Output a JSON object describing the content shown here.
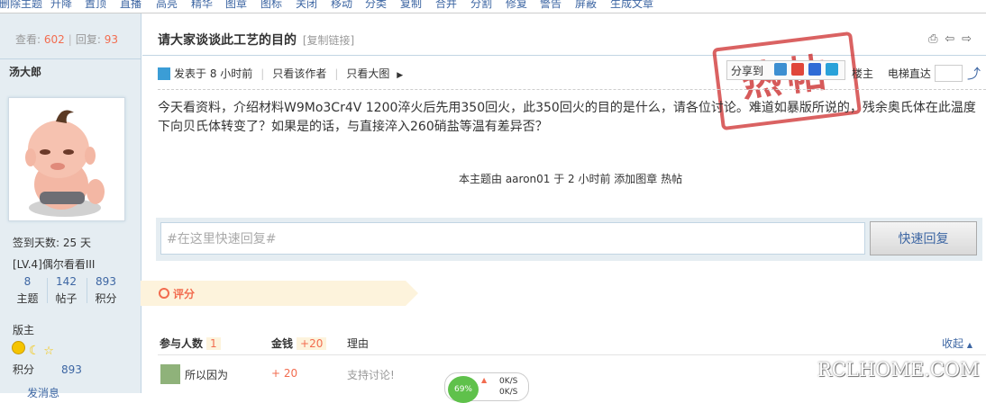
{
  "topbar": {
    "items": [
      "删除主题",
      "升降",
      "置顶",
      "直播",
      "高亮",
      "精华",
      "图章",
      "图标",
      "关闭",
      "移动",
      "分类",
      "复制",
      "合并",
      "分割",
      "修复",
      "警告",
      "屏蔽",
      "生成文章"
    ]
  },
  "sidebar": {
    "views_label": "查看:",
    "views": "602",
    "replies_label": "回复:",
    "replies": "93",
    "author": "汤大郎",
    "signin": "签到天数: 25 天",
    "level": "[LV.4]偶尔看看III",
    "counts": [
      {
        "num": "8",
        "label": "主题"
      },
      {
        "num": "142",
        "label": "帖子"
      },
      {
        "num": "893",
        "label": "积分"
      }
    ],
    "role": "版主",
    "score_label": "积分",
    "score_value": "893"
  },
  "post": {
    "title": "请大家谈谈此工艺的目的",
    "copy_link": "[复制链接]",
    "posted": "发表于 8 小时前",
    "only_author": "只看该作者",
    "only_big_img": "只看大图",
    "share_label": "分享到",
    "stamp": "热帖",
    "floor_label": "楼主",
    "jump_label": "电梯直达",
    "content": "今天看资料，介绍材料W9Mo3Cr4V  1200淬火后先用350回火，此350回火的目的是什么，请各位讨论。难道如暴版所说的，残余奥氏体在此温度下向贝氏体转变了？如果是的话，与直接淬入260硝盐等温有差异否？",
    "mod_note": "本主题由 aaron01 于 2 小时前 添加图章 热帖"
  },
  "reply": {
    "placeholder": "#在这里快速回复#",
    "button": "快速回复"
  },
  "rating": {
    "tab_label": "评分",
    "participants_label": "参与人数",
    "participants": "1",
    "money_label": "金钱",
    "money_total": "+20",
    "reason_label": "理由",
    "collapse": "收起",
    "rows": [
      {
        "user": "所以因为",
        "money": "+ 20",
        "reason": "支持讨论!"
      }
    ]
  },
  "widget": {
    "percent": "69%",
    "up": "0K/S",
    "down": "0K/S"
  },
  "watermark": "RCLHOME.COM",
  "bottom_link": "发消息"
}
